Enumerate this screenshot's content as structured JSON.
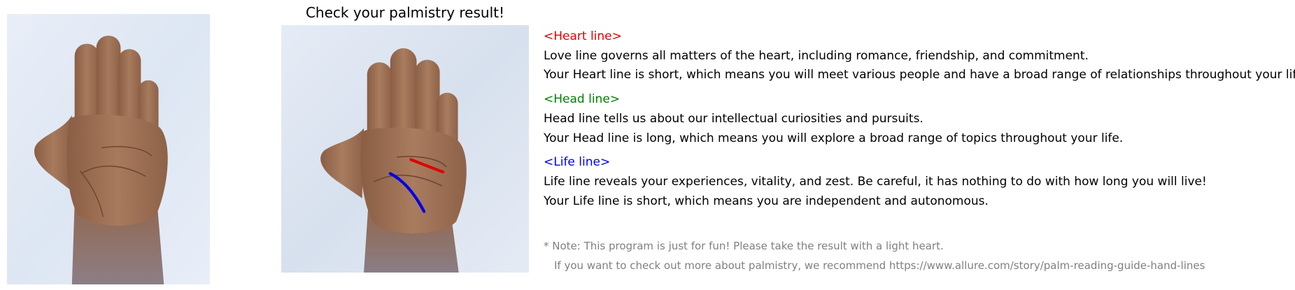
{
  "title": "Check your palmistry result!",
  "colors": {
    "heart": "#e00000",
    "head": "#008000",
    "life": "#0000e6",
    "note": "#808080",
    "background_light": "#e6edf7",
    "skin": "#9c6e52"
  },
  "sections": [
    {
      "heading": "<Heart line>",
      "lines": [
        "Love line governs all matters of the heart, including romance, friendship, and commitment.",
        "Your Heart line is short, which means you will meet various people and have a broad range of relationships throughout your life."
      ]
    },
    {
      "heading": "<Head line>",
      "lines": [
        "Head line tells us about our intellectual curiosities and pursuits.",
        "Your Head line is long, which means you will explore a broad range of topics throughout your life."
      ]
    },
    {
      "heading": "<Life line>",
      "lines": [
        "Life line reveals your experiences, vitality, and zest. Be careful, it has nothing to do with how long you will live!",
        "Your Life line is short, which means you are independent and autonomous."
      ]
    }
  ],
  "note": {
    "line1": "* Note: This program is just for fun! Please take the result with a light heart.",
    "line2": "If you want to check out more about palmistry, we recommend https://www.allure.com/story/palm-reading-guide-hand-lines"
  }
}
